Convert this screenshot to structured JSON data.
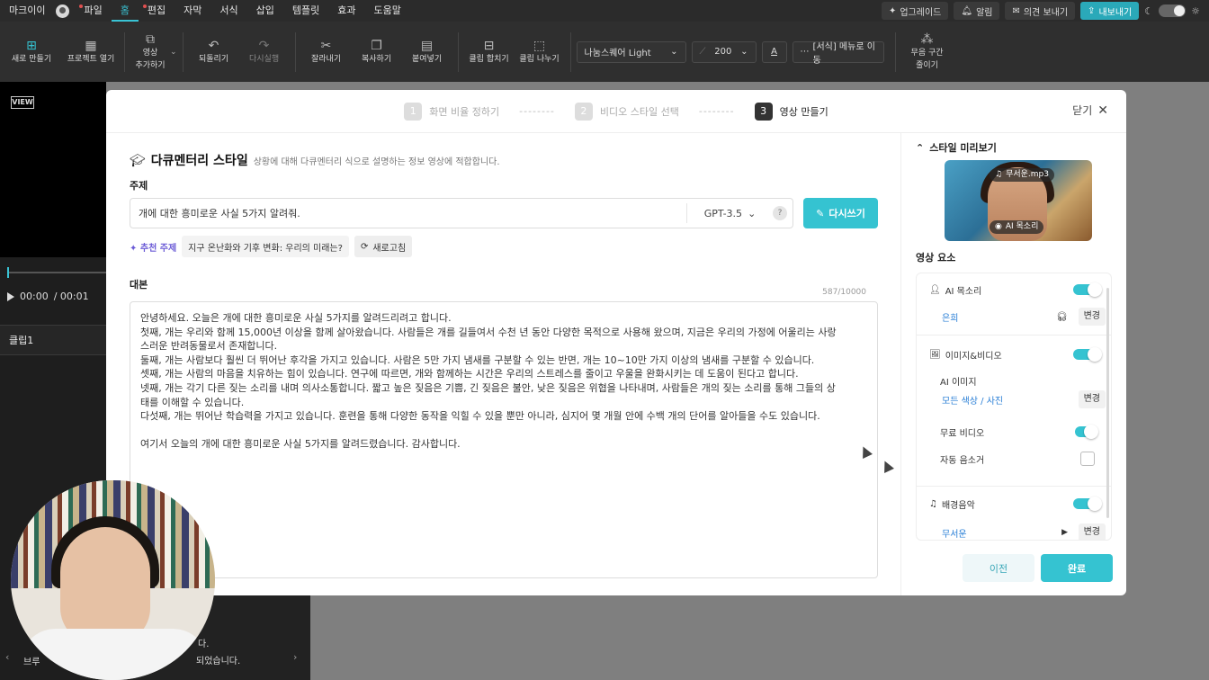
{
  "menubar": {
    "user": "마크이이",
    "menus": [
      "파일",
      "홈",
      "편집",
      "자막",
      "서식",
      "삽입",
      "템플릿",
      "효과",
      "도움말"
    ],
    "active_menu": "홈",
    "right": {
      "upgrade": "업그레이드",
      "notice": "알림",
      "feedback": "의견 보내기",
      "export": "내보내기"
    }
  },
  "toolbar": {
    "new": "새로 만들기",
    "open": "프로젝트 열기",
    "add_video_1": "영상",
    "add_video_2": "추가하기",
    "undo": "되돌리기",
    "redo": "다시실행",
    "cut": "잘라내기",
    "copy": "복사하기",
    "paste": "붙여넣기",
    "merge": "클립 합치기",
    "split": "클립 나누기",
    "font": "나눔스퀘어 Light",
    "font_size": "200",
    "format_move": "[서식] 메뉴로 이동",
    "trim_1": "무음 구간",
    "trim_2": "줄이기"
  },
  "left_panel": {
    "logo": "VIEW",
    "time_current": "00:00",
    "time_total": "/ 00:01",
    "clip_label": "클립1",
    "sub_line1": "다.",
    "sub_line2": "브루",
    "sub_line3": "되었습니다."
  },
  "steps": [
    {
      "num": "1",
      "label": "화면 비율 정하기"
    },
    {
      "num": "2",
      "label": "비디오 스타일 선택"
    },
    {
      "num": "3",
      "label": "영상 만들기"
    }
  ],
  "step_dots": "--------",
  "close_label": "닫기",
  "style": {
    "title": "다큐멘터리 스타일",
    "description": "상황에 대해 다큐멘터리 식으로 설명하는 정보 영상에 적합합니다."
  },
  "topic": {
    "label": "주제",
    "value": "개에 대한 흥미로운 사실 5가지 알려줘.",
    "model": "GPT-3.5",
    "help": "?",
    "rewrite": "다시쓰기"
  },
  "suggest": {
    "label": "추천 주제",
    "chip": "지구 온난화와 기후 변화: 우리의 미래는?",
    "refresh": "새로고침"
  },
  "script": {
    "label": "대본",
    "count": "587/10000",
    "lines": [
      "안녕하세요. 오늘은 개에 대한 흥미로운 사실 5가지를 알려드리려고 합니다.",
      "첫째, 개는 우리와 함께 15,000년 이상을 함께 살아왔습니다. 사람들은 개를 길들여서 수천 년 동안 다양한 목적으로 사용해 왔으며, 지금은 우리의 가정에 어울리는 사랑",
      "스러운 반려동물로서 존재합니다.",
      "둘째, 개는 사람보다 훨씬 더 뛰어난 후각을 가지고 있습니다. 사람은 5만 가지 냄새를 구분할 수 있는 반면, 개는 10~10만 가지 이상의 냄새를 구분할 수 있습니다.",
      "셋째, 개는 사람의 마음을 치유하는 힘이 있습니다. 연구에 따르면, 개와 함께하는 시간은 우리의 스트레스를 줄이고 우울을 완화시키는 데 도움이 된다고 합니다.",
      "넷째, 개는 각기 다른 짖는 소리를 내며 의사소통합니다. 짧고 높은 짖음은 기쁨, 긴 짖음은 불안, 낮은 짖음은 위협을 나타내며, 사람들은 개의 짖는 소리를 통해 그들의 상",
      "태를 이해할 수 있습니다.",
      "다섯째, 개는 뛰어난 학습력을 가지고 있습니다. 훈련을 통해 다양한 동작을 익힐 수 있을 뿐만 아니라, 심지어 몇 개월 안에 수백 개의 단어를 알아들을 수도 있습니다."
    ],
    "closing": "여기서 오늘의 개에 대한 흥미로운 사실 5가지를 알려드렸습니다. 감사합니다."
  },
  "side": {
    "preview_title": "스타일 미리보기",
    "music_pill": "무서운.mp3",
    "voice_pill": "AI 목소리",
    "elements_title": "영상 요소",
    "ai_voice": "AI 목소리",
    "voice_name": "은희",
    "change": "변경",
    "image_video": "이미지&비디오",
    "ai_image": "AI 이미지",
    "image_type": "모든 색상 / 사진",
    "free_video": "무료 비디오",
    "auto_remove": "자동 음소거",
    "bgm": "배경음악",
    "bgm_name": "무서운",
    "prev": "이전",
    "done": "완료"
  },
  "colors": {
    "accent": "#35c3d1",
    "link": "#2a7fd6",
    "recommend": "#6b5bd6"
  }
}
